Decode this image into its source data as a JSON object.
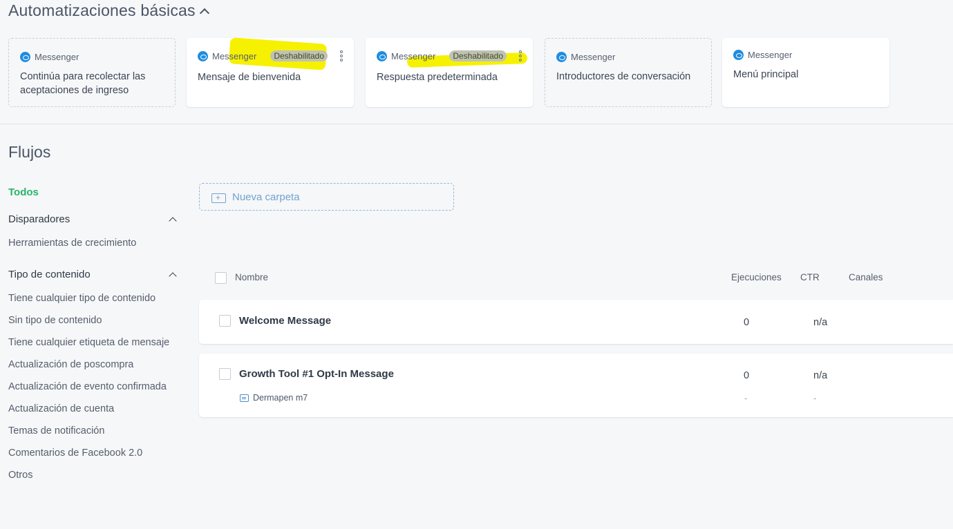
{
  "header": {
    "title": "Automatizaciones básicas"
  },
  "cards": [
    {
      "channel": "Messenger",
      "title": "Continúa para recolectar las aceptaciones de ingreso",
      "badge": ""
    },
    {
      "channel": "Messenger",
      "title": "Mensaje de bienvenida",
      "badge": "Deshabilitado"
    },
    {
      "channel": "Messenger",
      "title": "Respuesta predeterminada",
      "badge": "Deshabilitado"
    },
    {
      "channel": "Messenger",
      "title": "Introductores de conversación",
      "badge": ""
    },
    {
      "channel": "Messenger",
      "title": "Menú principal",
      "badge": ""
    }
  ],
  "flows": {
    "title": "Flujos",
    "new_folder": "Nueva carpeta"
  },
  "sidebar": {
    "todos": "Todos",
    "triggers": {
      "title": "Disparadores",
      "items": [
        "Herramientas de crecimiento"
      ]
    },
    "content_type": {
      "title": "Tipo de contenido",
      "items": [
        "Tiene cualquier tipo de contenido",
        "Sin tipo de contenido",
        "Tiene cualquier etiqueta de mensaje",
        "Actualización de poscompra",
        "Actualización de evento confirmada",
        "Actualización de cuenta",
        "Temas de notificación",
        "Comentarios de Facebook 2.0",
        "Otros"
      ]
    }
  },
  "table": {
    "columns": {
      "name": "Nombre",
      "runs": "Ejecuciones",
      "ctr": "CTR",
      "channels": "Canales"
    },
    "rows": [
      {
        "name": "Welcome Message",
        "runs": "0",
        "ctr": "n/a",
        "channel_icon": "messenger-icon"
      },
      {
        "name": "Growth Tool #1 Opt-In Message",
        "runs": "0",
        "ctr": "n/a",
        "channel_icon": "messenger-icon",
        "tag": "Dermapen m7",
        "sub_runs": "-",
        "sub_ctr": "-"
      }
    ]
  },
  "colors": {
    "accent_green": "#27b46a",
    "messenger_blue": "#1f8de0",
    "highlight": "#f6f100"
  }
}
